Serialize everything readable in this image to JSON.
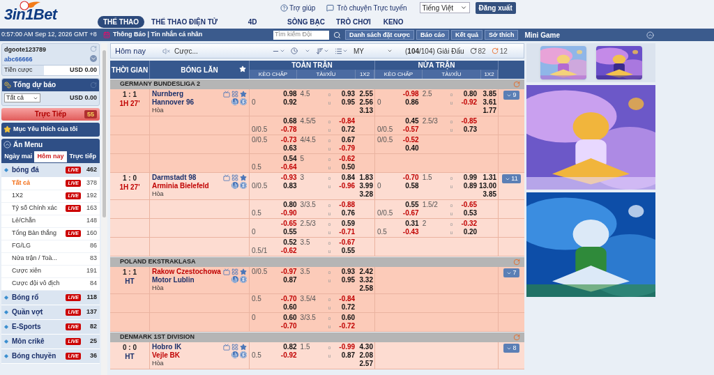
{
  "header": {
    "logo": "3in1Bet",
    "help": "Trợ giúp",
    "chat": "Trò chuyện Trực tuyến",
    "language": "Tiếng Việt",
    "logout": "Đăng xuất",
    "nav": [
      {
        "label": "THỂ THAO",
        "selected": true
      },
      {
        "label": "THỂ THAO ĐIỆN TỬ",
        "selected": false
      },
      {
        "label": "4D",
        "selected": false
      },
      {
        "label": "SÒNG BẠC",
        "selected": false
      },
      {
        "label": "TRÒ CHƠI",
        "selected": false
      },
      {
        "label": "KENO",
        "selected": false
      }
    ]
  },
  "subbar": {
    "clock": "0:57:00 AM Sep 12, 2026 GMT +8",
    "notice": "Thông Báo | Tin nhắn cá nhân",
    "search": {
      "placeholder": "Tìm kiếm Đội"
    },
    "buttons": [
      "Danh sách đặt cược",
      "Báo cáo",
      "Kết quả",
      "Sở thích"
    ],
    "mini_game": "Mini Game"
  },
  "sidebar": {
    "account": {
      "username": "dgoote123789",
      "code": "abc66666",
      "bet_label": "Tiền cược",
      "bet_value": "USD 0.00"
    },
    "forecast": {
      "title": "Tổng dự báo",
      "filter": "Tất cả",
      "amount": "USD 0.00"
    },
    "live": {
      "label": "Trực Tiếp",
      "count": "55"
    },
    "favorites": "Mục Yêu thích của tôi",
    "menu_title": "Ẩn Menu",
    "tabs": [
      {
        "label": "Ngày mai",
        "selected": false
      },
      {
        "label": "Hôm nay",
        "selected": true
      },
      {
        "label": "Trực tiếp",
        "selected": false
      }
    ],
    "sports": [
      {
        "label": "bóng đá",
        "badge": "LIVE",
        "count": "462",
        "selected": false,
        "children": [
          {
            "label": "Tất cả",
            "badge": "LIVE",
            "count": "378",
            "selected": true
          },
          {
            "label": "1X2",
            "badge": "LIVE",
            "count": "192",
            "selected": false
          },
          {
            "label": "Tỷ số Chính xác",
            "badge": "LIVE",
            "count": "163",
            "selected": false
          },
          {
            "label": "Lẻ/Chẵn",
            "count": "148",
            "selected": false
          },
          {
            "label": "Tổng Bàn thắng",
            "badge": "LIVE",
            "count": "160",
            "selected": false
          },
          {
            "label": "FG/LG",
            "count": "86",
            "selected": false
          },
          {
            "label": "Nửa trận / Toà...",
            "count": "83",
            "selected": false
          },
          {
            "label": "Cược xiên",
            "count": "191",
            "selected": false
          },
          {
            "label": "Cược đội vô địch",
            "count": "84",
            "selected": false
          }
        ]
      },
      {
        "label": "Bóng rổ",
        "badge": "LIVE",
        "count": "118",
        "selected": false
      },
      {
        "label": "Quần vợt",
        "badge": "LIVE",
        "count": "137",
        "selected": false
      },
      {
        "label": "E-Sports",
        "badge": "LIVE",
        "count": "82",
        "selected": false
      },
      {
        "label": "Môn crikê",
        "badge": "LIVE",
        "count": "25",
        "selected": false
      },
      {
        "label": "Bóng chuyền",
        "badge": "LIVE",
        "count": "36",
        "selected": false
      }
    ]
  },
  "toolbar": {
    "title": "Hôm nay",
    "bet_filter": "Cược...",
    "odds_type": "MY",
    "leagues": "(**104**/104) Giải Đấu",
    "refresh_a": "82",
    "refresh_b": "12"
  },
  "table": {
    "columns": {
      "time": "THỜI GIAN",
      "match": "BÓNG LĂN",
      "full": "TOÀN TRẬN",
      "half": "NỬA TRẬN",
      "full_sub": [
        "KÈO CHẤP",
        "TÀI/XỈU",
        "1X2"
      ],
      "half_sub": [
        "KÈO CHẤP",
        "TÀI/XỈU",
        "1X2"
      ]
    },
    "leagues": [
      {
        "name": "GERMANY BUNDESLIGA 2",
        "matches": [
          {
            "score": "1 : 1",
            "period": "1H 27'",
            "in_play": true,
            "teams": [
              {
                "name": "Nurnberg",
                "favorite": false
              },
              {
                "name": "Hannover 96",
                "favorite": false
              }
            ],
            "draw": "Hòa",
            "more": "9",
            "lines": [
              {
                "rows": [
                  {
                    "ft": {
                      "hdp_odds": "0.98",
                      "ou": "4.5",
                      "side": "o",
                      "ou_odds": "0.93",
                      "x12": "2.55"
                    },
                    "ht": {
                      "hdp_odds": "-0.98",
                      "ou": "2.5",
                      "side": "o",
                      "ou_odds": "0.80",
                      "x12": "3.85"
                    }
                  },
                  {
                    "ft": {
                      "hdp": "0",
                      "hdp_odds": "0.92",
                      "side": "u",
                      "ou_odds": "0.95",
                      "x12": "2.56"
                    },
                    "ht": {
                      "hdp": "0",
                      "hdp_odds": "0.86",
                      "side": "u",
                      "ou_odds": "-0.92",
                      "x12": "3.61"
                    }
                  },
                  {
                    "ft": {
                      "x12": "3.13"
                    },
                    "ht": {
                      "x12": "1.77"
                    }
                  }
                ]
              },
              {
                "rows": [
                  {
                    "ft": {
                      "hdp_odds": "0.68",
                      "ou": "4.5/5",
                      "side": "o",
                      "ou_odds": "-0.84"
                    },
                    "ht": {
                      "hdp_odds": "0.45",
                      "ou": "2.5/3",
                      "side": "o",
                      "ou_odds": "-0.85"
                    }
                  },
                  {
                    "ft": {
                      "hdp": "0/0.5",
                      "hdp_odds": "-0.78",
                      "side": "u",
                      "ou_odds": "0.72"
                    },
                    "ht": {
                      "hdp": "0/0.5",
                      "hdp_odds": "-0.57",
                      "side": "u",
                      "ou_odds": "0.73"
                    }
                  }
                ]
              },
              {
                "rows": [
                  {
                    "ft": {
                      "hdp": "0/0.5",
                      "hdp_odds": "-0.73",
                      "ou": "4/4.5",
                      "side": "o",
                      "ou_odds": "0.67"
                    },
                    "ht": {
                      "hdp": "0/0.5",
                      "hdp_odds": "-0.52"
                    }
                  },
                  {
                    "ft": {
                      "hdp_odds": "0.63",
                      "side": "u",
                      "ou_odds": "-0.79"
                    },
                    "ht": {
                      "hdp_odds": "0.40"
                    }
                  }
                ]
              },
              {
                "rows": [
                  {
                    "ft": {
                      "hdp_odds": "0.54",
                      "ou": "5",
                      "side": "o",
                      "ou_odds": "-0.62"
                    }
                  },
                  {
                    "ft": {
                      "hdp": "0.5",
                      "hdp_odds": "-0.64",
                      "side": "u",
                      "ou_odds": "0.50"
                    }
                  }
                ]
              }
            ]
          },
          {
            "score": "1 : 0",
            "period": "1H 27'",
            "in_play": true,
            "teams": [
              {
                "name": "Darmstadt 98",
                "favorite": false
              },
              {
                "name": "Arminia Bielefeld",
                "favorite": true
              }
            ],
            "draw": "Hòa",
            "more": "11",
            "lines": [
              {
                "rows": [
                  {
                    "ft": {
                      "hdp_odds": "-0.93",
                      "ou": "3",
                      "side": "o",
                      "ou_odds": "0.84",
                      "x12": "1.83"
                    },
                    "ht": {
                      "hdp_odds": "-0.70",
                      "ou": "1.5",
                      "side": "o",
                      "ou_odds": "0.99",
                      "x12": "1.31"
                    }
                  },
                  {
                    "ft": {
                      "hdp": "0/0.5",
                      "hdp_odds": "0.83",
                      "side": "u",
                      "ou_odds": "-0.96",
                      "x12": "3.99"
                    },
                    "ht": {
                      "hdp": "0",
                      "hdp_odds": "0.58",
                      "side": "u",
                      "ou_odds": "0.89",
                      "x12": "13.00"
                    }
                  },
                  {
                    "ft": {
                      "x12": "3.28"
                    },
                    "ht": {
                      "x12": "3.85"
                    }
                  }
                ]
              },
              {
                "rows": [
                  {
                    "ft": {
                      "hdp_odds": "0.80",
                      "ou": "3/3.5",
                      "side": "o",
                      "ou_odds": "-0.88"
                    },
                    "ht": {
                      "hdp_odds": "0.55",
                      "ou": "1.5/2",
                      "side": "o",
                      "ou_odds": "-0.65"
                    }
                  },
                  {
                    "ft": {
                      "hdp": "0.5",
                      "hdp_odds": "-0.90",
                      "side": "u",
                      "ou_odds": "0.76"
                    },
                    "ht": {
                      "hdp": "0/0.5",
                      "hdp_odds": "-0.67",
                      "side": "u",
                      "ou_odds": "0.53"
                    }
                  }
                ]
              },
              {
                "rows": [
                  {
                    "ft": {
                      "hdp_odds": "-0.65",
                      "ou": "2.5/3",
                      "side": "o",
                      "ou_odds": "0.59"
                    },
                    "ht": {
                      "hdp_odds": "0.31",
                      "ou": "2",
                      "side": "o",
                      "ou_odds": "-0.32"
                    }
                  },
                  {
                    "ft": {
                      "hdp": "0",
                      "hdp_odds": "0.55",
                      "side": "u",
                      "ou_odds": "-0.71"
                    },
                    "ht": {
                      "hdp": "0.5",
                      "hdp_odds": "-0.43",
                      "side": "u",
                      "ou_odds": "0.20"
                    }
                  }
                ]
              },
              {
                "rows": [
                  {
                    "ft": {
                      "hdp_odds": "0.52",
                      "ou": "3.5",
                      "side": "o",
                      "ou_odds": "-0.67"
                    }
                  },
                  {
                    "ft": {
                      "hdp": "0.5/1",
                      "hdp_odds": "-0.62",
                      "side": "u",
                      "ou_odds": "0.55"
                    }
                  }
                ]
              }
            ]
          }
        ]
      },
      {
        "name": "POLAND EKSTRAKLASA",
        "matches": [
          {
            "score": "1 : 1",
            "period": "HT",
            "in_play": false,
            "teams": [
              {
                "name": "Rakow Czestochowa",
                "favorite": true
              },
              {
                "name": "Motor Lublin",
                "favorite": false
              }
            ],
            "draw": "Hòa",
            "more": "7",
            "lines": [
              {
                "rows": [
                  {
                    "ft": {
                      "hdp": "0/0.5",
                      "hdp_odds": "-0.97",
                      "ou": "3.5",
                      "side": "o",
                      "ou_odds": "0.93",
                      "x12": "2.42"
                    }
                  },
                  {
                    "ft": {
                      "hdp_odds": "0.87",
                      "side": "u",
                      "ou_odds": "0.95",
                      "x12": "3.32"
                    }
                  },
                  {
                    "ft": {
                      "x12": "2.58"
                    }
                  }
                ]
              },
              {
                "rows": [
                  {
                    "ft": {
                      "hdp": "0.5",
                      "hdp_odds": "-0.70",
                      "ou": "3.5/4",
                      "side": "o",
                      "ou_odds": "-0.84"
                    }
                  },
                  {
                    "ft": {
                      "hdp_odds": "0.60",
                      "side": "u",
                      "ou_odds": "0.72"
                    }
                  }
                ]
              },
              {
                "rows": [
                  {
                    "ft": {
                      "hdp": "0",
                      "hdp_odds": "0.60",
                      "ou": "3/3.5",
                      "side": "o",
                      "ou_odds": "0.60"
                    }
                  },
                  {
                    "ft": {
                      "hdp_odds": "-0.70",
                      "side": "u",
                      "ou_odds": "-0.72"
                    }
                  }
                ]
              }
            ]
          }
        ]
      },
      {
        "name": "DENMARK 1ST DIVISION",
        "matches": [
          {
            "score": "0 : 0",
            "period": "HT",
            "in_play": false,
            "teams": [
              {
                "name": "Hobro IK",
                "favorite": false
              },
              {
                "name": "Vejle BK",
                "favorite": true
              }
            ],
            "draw": "Hòa",
            "more": "8",
            "lines": [
              {
                "rows": [
                  {
                    "ft": {
                      "hdp_odds": "0.82",
                      "ou": "1.5",
                      "side": "o",
                      "ou_odds": "-0.99",
                      "x12": "4.30"
                    }
                  },
                  {
                    "ft": {
                      "hdp": "0.5",
                      "hdp_odds": "-0.92",
                      "side": "u",
                      "ou_odds": "0.87",
                      "x12": "2.08"
                    }
                  },
                  {
                    "ft": {
                      "x12": "2.57"
                    }
                  }
                ]
              }
            ]
          }
        ]
      }
    ]
  }
}
